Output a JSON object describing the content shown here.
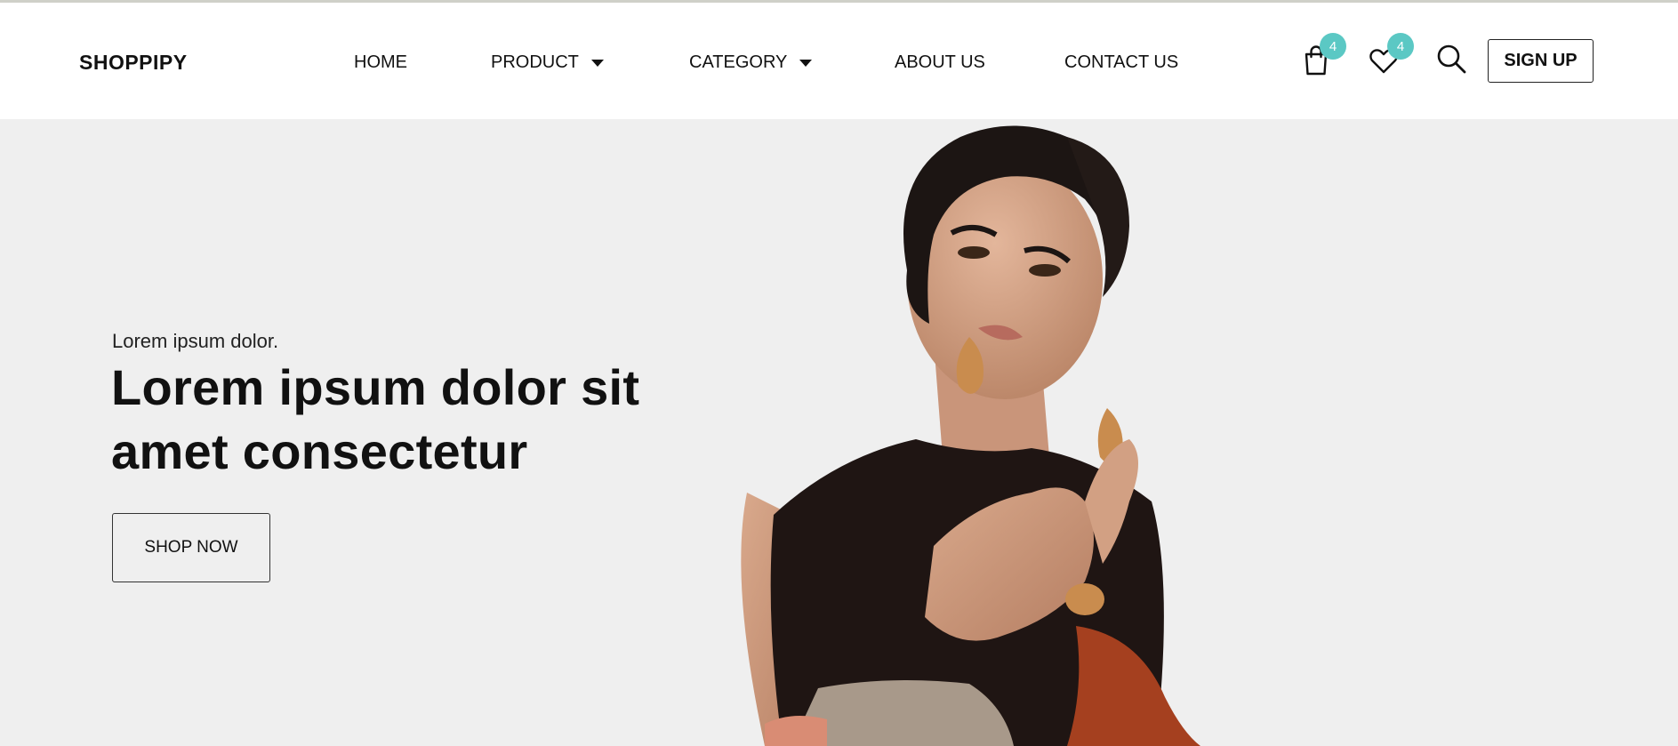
{
  "brand": "SHOPPIPY",
  "nav": {
    "home": "HOME",
    "product": "PRODUCT",
    "category": "CATEGORY",
    "about": "ABOUT US",
    "contact": "CONTACT US"
  },
  "cart": {
    "icon": "shopping-bag-icon",
    "count": "4"
  },
  "wishlist": {
    "icon": "heart-icon",
    "count": "4"
  },
  "search": {
    "icon": "search-icon"
  },
  "signup_label": "SIGN UP",
  "hero": {
    "kicker": "Lorem ipsum dolor.",
    "title": "Lorem ipsum dolor sit amet consectetur",
    "cta": "SHOP NOW"
  },
  "colors": {
    "badge": "#5bc8c4",
    "hero_bg": "#efefef"
  }
}
